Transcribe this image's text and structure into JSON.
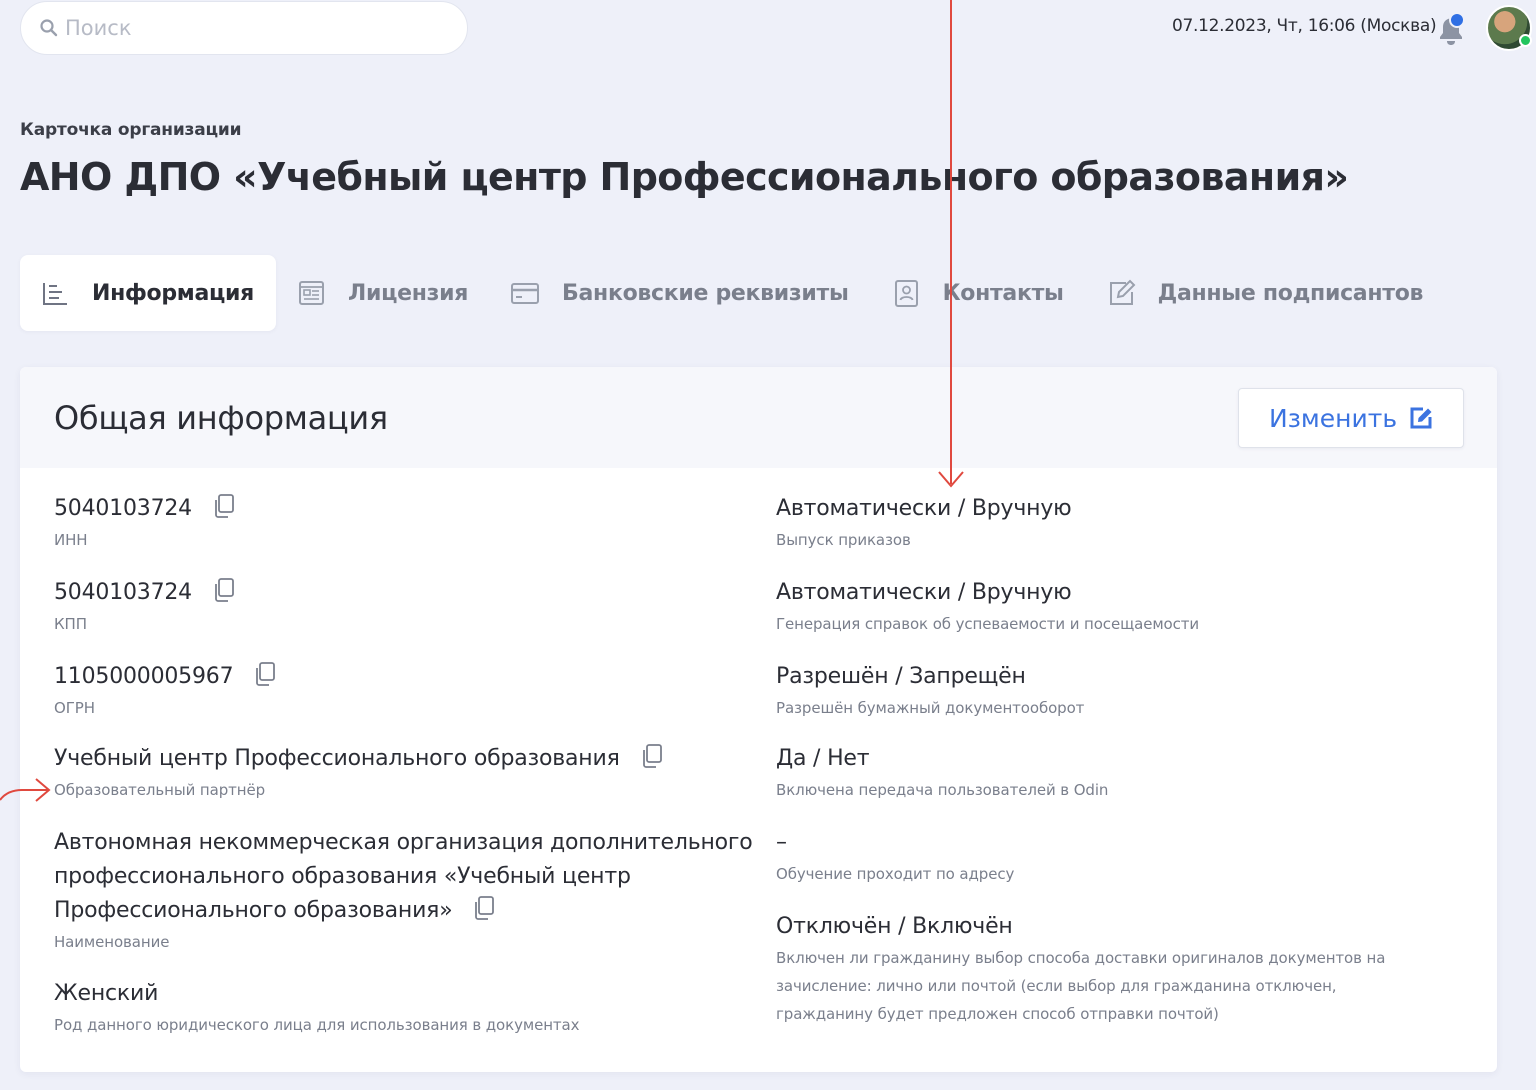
{
  "search": {
    "placeholder": "Поиск"
  },
  "header": {
    "datetime": "07.12.2023, Чт, 16:06 (Москва)"
  },
  "breadcrumb": "Карточка организации",
  "page_title": "АНО ДПО «Учебный центр Профессионального образования»",
  "tabs": [
    {
      "label": "Информация",
      "icon": "list-icon",
      "active": true
    },
    {
      "label": "Лицензия",
      "icon": "document-icon"
    },
    {
      "label": "Банковские реквизиты",
      "icon": "card-icon"
    },
    {
      "label": "Контакты",
      "icon": "contact-icon"
    },
    {
      "label": "Данные подписантов",
      "icon": "edit-icon"
    }
  ],
  "card": {
    "title": "Общая информация",
    "edit_label": "Изменить"
  },
  "left_fields": [
    {
      "value": "5040103724",
      "label": "ИНН"
    },
    {
      "value": "5040103724",
      "label": "КПП"
    },
    {
      "value": "1105000005967",
      "label": "ОГРН"
    },
    {
      "value": "Учебный центр Профессионального образования",
      "label": "Образовательный партнёр"
    },
    {
      "value": "Автономная некоммерческая организация дополнительного профессионального образования «Учебный центр Профессионального образования»",
      "label": "Наименование"
    },
    {
      "value": "Женский",
      "label": "Род данного юридического лица для использования в документах"
    }
  ],
  "right_fields": [
    {
      "value": "Автоматически / Вручную",
      "label": "Выпуск приказов"
    },
    {
      "value": "Автоматически / Вручную",
      "label": "Генерация справок об успеваемости и посещаемости"
    },
    {
      "value": "Разрешён / Запрещён",
      "label": "Разрешён бумажный документооборот"
    },
    {
      "value": "Да / Нет",
      "label": "Включена передача пользователей в Odin"
    },
    {
      "value": "–",
      "label": "Обучение проходит по адресу"
    },
    {
      "value": "Отключён / Включён",
      "label": "Включен ли гражданину выбор способа доставки оригиналов документов на зачисление: лично или почтой (если выбор для гражданина отключен, гражданину будет предложен способ отправки почтой)"
    }
  ],
  "colors": {
    "accent": "#3b73e0",
    "annotation": "#e0493f",
    "background": "#eef0f9"
  }
}
